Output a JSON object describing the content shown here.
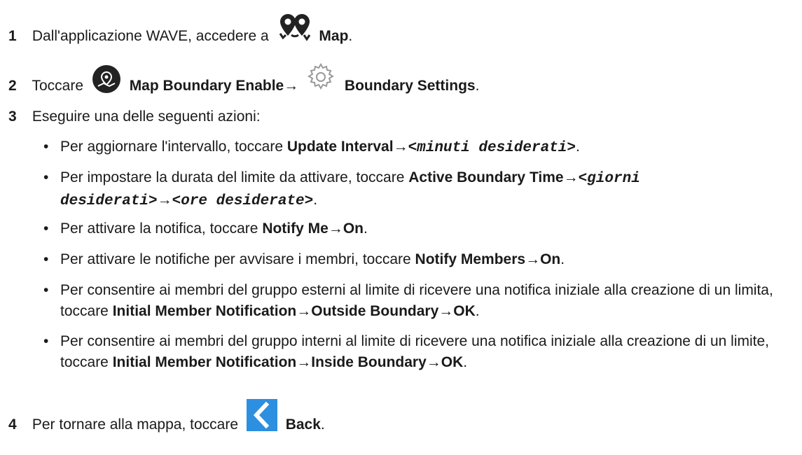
{
  "steps": [
    {
      "num": "1",
      "text1": "Dall'applicazione WAVE, accedere a",
      "icon": "map-pins-icon",
      "bold": "Map",
      "end": "."
    },
    {
      "num": "2",
      "text1": "Toccare",
      "icon1": "map-boundary-icon",
      "bold1": "Map Boundary Enable",
      "arrow": "→",
      "icon2": "gear-icon",
      "bold2": "Boundary Settings",
      "end": "."
    },
    {
      "num": "3",
      "text1": "Eseguire una delle seguenti azioni:"
    },
    {
      "num": "4",
      "text1": "Per tornare alla mappa, toccare",
      "icon": "back-chevron-icon",
      "bold": "Back",
      "end": "."
    }
  ],
  "bullets": [
    {
      "dot": "•",
      "pre": "Per aggiornare l'intervallo, toccare ",
      "b1": "Update Interval",
      "a1": "→",
      "m1": "<minuti desiderati>",
      "end": "."
    },
    {
      "dot": "•",
      "pre": "Per impostare la durata del limite da attivare, toccare ",
      "b1": "Active Boundary Time",
      "a1": "→",
      "m1": "<giorni desiderati>",
      "a2": "→",
      "m2": "<ore desiderate>",
      "end": "."
    },
    {
      "dot": "•",
      "pre": "Per attivare la notifica, toccare ",
      "b1": "Notify Me",
      "a1": "→",
      "b2": "On",
      "end": "."
    },
    {
      "dot": "•",
      "pre": "Per attivare le notifiche per avvisare i membri, toccare ",
      "b1": "Notify Members",
      "a1": "→",
      "b2": "On",
      "end": "."
    },
    {
      "dot": "•",
      "pre": "Per consentire ai membri del gruppo esterni al limite di ricevere una notifica iniziale alla creazione di un limita, toccare ",
      "b1": "Initial Member Notification",
      "a1": "→",
      "b2": "Outside Boundary",
      "a2": "→",
      "b3": "OK",
      "end": "."
    },
    {
      "dot": "•",
      "pre": "Per consentire ai membri del gruppo interni al limite di ricevere una notifica iniziale alla creazione di un limite, toccare ",
      "b1": "Initial Member Notification",
      "a1": "→",
      "b2": "Inside Boundary",
      "a2": "→",
      "b3": "OK",
      "end": "."
    }
  ],
  "colors": {
    "text": "#1a1a1a",
    "back_button": "#2d8fe0",
    "icon_dark": "#222222",
    "gear": "#9a9a9a"
  }
}
